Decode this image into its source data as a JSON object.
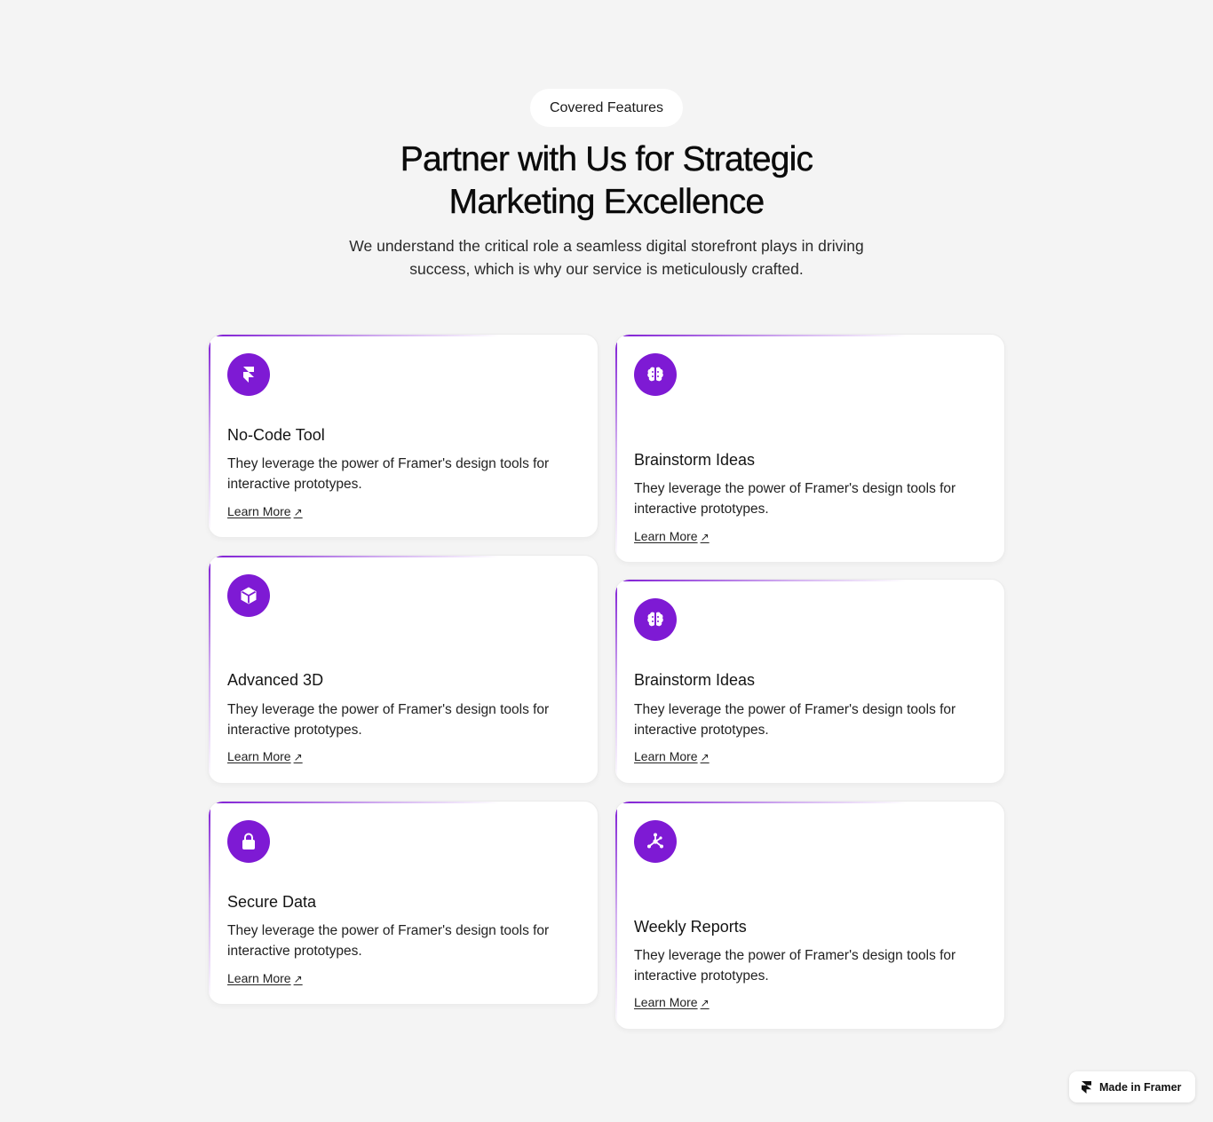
{
  "header": {
    "badge": "Covered Features",
    "title": "Partner with Us for Strategic Marketing Excellence",
    "subtitle": "We understand the critical role a seamless digital storefront plays in driving success, which is why our service is meticulously crafted."
  },
  "cards": [
    {
      "icon": "framer-icon",
      "title": "No-Code Tool",
      "description": "They leverage the power of Framer's design tools for interactive prototypes.",
      "link": "Learn More"
    },
    {
      "icon": "cube-icon",
      "title": "Advanced 3D",
      "description": "They leverage the power of Framer's design tools for interactive prototypes.",
      "link": "Learn More"
    },
    {
      "icon": "lock-icon",
      "title": "Secure Data",
      "description": "They leverage the power of Framer's design tools for interactive prototypes.",
      "link": "Learn More"
    },
    {
      "icon": "brain-icon",
      "title": "Brainstorm Ideas",
      "description": "They leverage the power of Framer's design tools for interactive prototypes.",
      "link": "Learn More"
    },
    {
      "icon": "brain-icon",
      "title": "Brainstorm Ideas",
      "description": "They leverage the power of Framer's design tools for interactive prototypes.",
      "link": "Learn More"
    },
    {
      "icon": "network-icon",
      "title": "Weekly Reports",
      "description": "They leverage the power of Framer's design tools for interactive prototypes.",
      "link": "Learn More"
    }
  ],
  "link_arrow": "↗",
  "footer_badge": {
    "icon": "framer-icon",
    "label": "Made in Framer"
  },
  "colors": {
    "accent": "#7e1ad4",
    "background": "#f4f4f4",
    "card": "#ffffff"
  }
}
